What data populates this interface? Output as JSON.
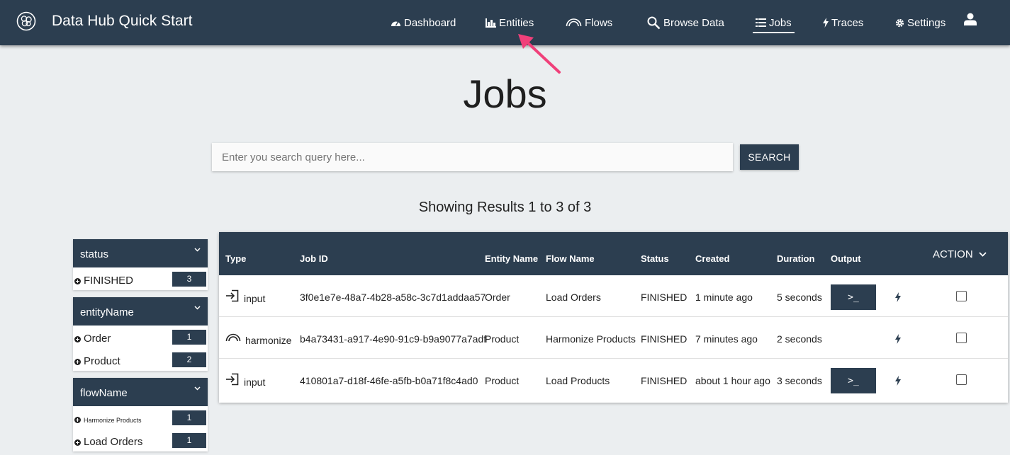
{
  "app": {
    "title": "Data Hub Quick Start"
  },
  "nav": {
    "dashboard": "Dashboard",
    "entities": "Entities",
    "flows": "Flows",
    "browse_data": "Browse Data",
    "jobs": "Jobs",
    "traces": "Traces",
    "settings": "Settings"
  },
  "page": {
    "title": "Jobs"
  },
  "search": {
    "placeholder": "Enter you search query here...",
    "button_label": "SEARCH"
  },
  "results_summary": "Showing Results 1 to 3 of 3",
  "facets": {
    "status": {
      "title": "status",
      "items": [
        {
          "label": "FINISHED",
          "count": "3"
        }
      ]
    },
    "entityName": {
      "title": "entityName",
      "items": [
        {
          "label": "Order",
          "count": "1"
        },
        {
          "label": "Product",
          "count": "2"
        }
      ]
    },
    "flowName": {
      "title": "flowName",
      "items": [
        {
          "label": "Harmonize Products",
          "count": "1"
        },
        {
          "label": "Load Orders",
          "count": "1"
        }
      ]
    }
  },
  "table": {
    "headers": {
      "type": "Type",
      "job_id": "Job ID",
      "entity_name": "Entity Name",
      "flow_name": "Flow Name",
      "status": "Status",
      "created": "Created",
      "duration": "Duration",
      "output": "Output",
      "action": "ACTION"
    },
    "output_button_label": ">_",
    "rows": [
      {
        "type": "input",
        "job_id": "3f0e1e7e-48a7-4b28-a58c-3c7d1addaa57",
        "entity_name": "Order",
        "flow_name": "Load Orders",
        "status": "FINISHED",
        "created": "1 minute ago",
        "duration": "5 seconds",
        "has_output": true
      },
      {
        "type": "harmonize",
        "job_id": "b4a73431-a917-4e90-91c9-b9a9077a7adf",
        "entity_name": "Product",
        "flow_name": "Harmonize Products",
        "status": "FINISHED",
        "created": "7 minutes ago",
        "duration": "2 seconds",
        "has_output": false
      },
      {
        "type": "input",
        "job_id": "410801a7-d18f-46fe-a5fb-b0a71f8c4ad0",
        "entity_name": "Product",
        "flow_name": "Load Products",
        "status": "FINISHED",
        "created": "about 1 hour ago",
        "duration": "3 seconds",
        "has_output": true
      }
    ]
  },
  "colors": {
    "primary": "#2c3e50",
    "background": "#ebeef0",
    "annotation_arrow": "#f0407a"
  }
}
